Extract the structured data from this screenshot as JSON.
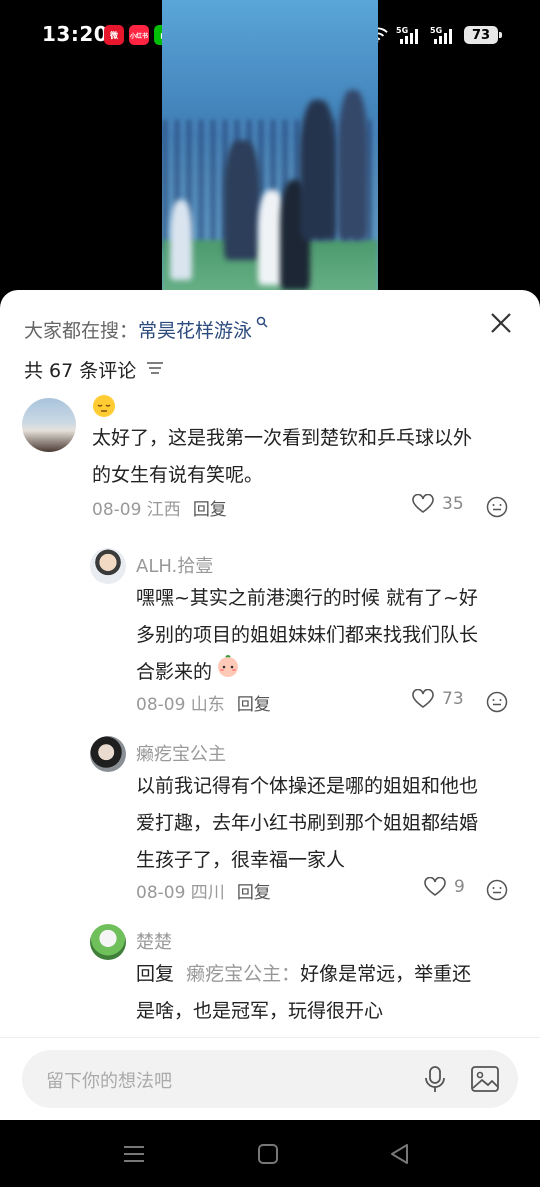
{
  "status": {
    "time": "13:20",
    "battery": "73",
    "network": "5G",
    "apps": [
      {
        "name": "weibo-app-icon",
        "color": "#e6162d",
        "label": "微"
      },
      {
        "name": "xiaohongshu-app-icon",
        "color": "#ff2442",
        "label": "小红书"
      },
      {
        "name": "iqiyi-app-icon",
        "color": "#00be06",
        "label": "▶"
      },
      {
        "name": "tiktok-app-icon",
        "color": "#111111",
        "label": "♪"
      }
    ]
  },
  "sheet": {
    "search_prefix": "大家都在搜：",
    "search_keyword": "常昊花样游泳",
    "comment_count": "共 67 条评论"
  },
  "comments": {
    "c1": {
      "text_line1": "太好了，这是我第一次看到楚钦和乒乓球以外",
      "text_line2": "的女生有说有笑呢。",
      "date_loc": "08-09 江西",
      "reply": "回复",
      "likes": "35"
    },
    "c2": {
      "name": "ALH.拾壹",
      "text_line1": "嘿嘿~其实之前港澳行的时候 就有了~好",
      "text_line2": "多别的项目的姐姐妹妹们都来找我们队长",
      "text_line3": "合影来的",
      "date_loc": "08-09 山东",
      "reply": "回复",
      "likes": "73"
    },
    "c3": {
      "name": "癞疙宝公主",
      "text_line1": "以前我记得有个体操还是哪的姐姐和他也",
      "text_line2": "爱打趣，去年小红书刷到那个姐姐都结婚",
      "text_line3": "生孩子了，很幸福一家人",
      "date_loc": "08-09 四川",
      "reply": "回复",
      "likes": "9"
    },
    "c4": {
      "name": "楚楚",
      "reply_prefix": "回复",
      "reply_to": "癞疙宝公主：",
      "text_line1": "好像是常远，举重还",
      "text_line2": "是啥，也是冠军，玩得很开心"
    }
  },
  "input": {
    "placeholder": "留下你的想法吧"
  },
  "colors": {
    "accent_keyword": "#2b4a7d",
    "sheet_bg": "#ffffff",
    "muted": "#999999"
  }
}
